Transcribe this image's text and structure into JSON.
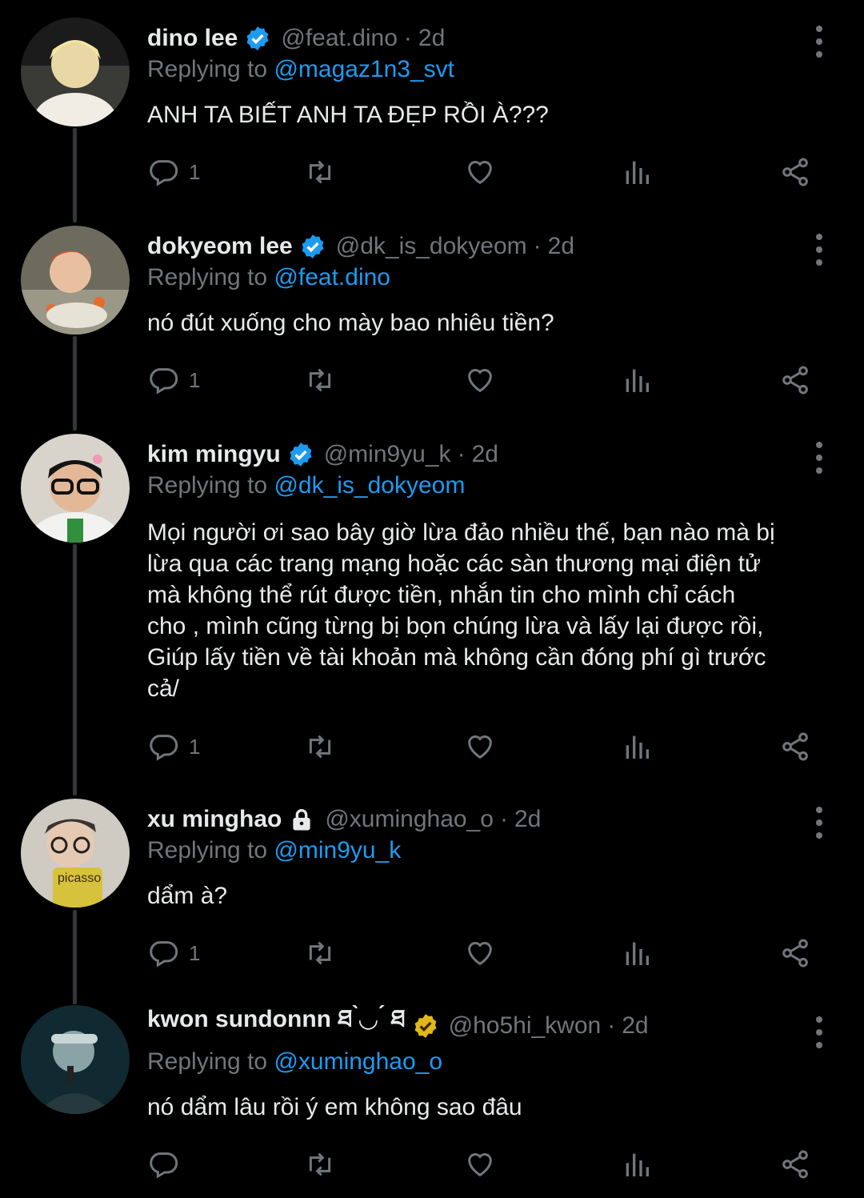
{
  "replying_prefix": "Replying to ",
  "colors": {
    "link": "#1d9bf0",
    "muted": "#71767b",
    "text": "#e7e9ea",
    "verified_blue": "#1d9bf0",
    "verified_gold": "#e2b719"
  },
  "tweets": [
    {
      "name": "dino lee",
      "badge": "verified-blue-icon",
      "handle": "@feat.dino",
      "dot": "·",
      "time": "2d",
      "replying_to": "@magaz1n3_svt",
      "lines": [
        "ANH TA BIẾT ANH TA ĐẸP RỒI À???"
      ],
      "reply_count": "1"
    },
    {
      "name": "dokyeom lee",
      "badge": "verified-blue-icon",
      "handle": "@dk_is_dokyeom",
      "dot": "·",
      "time": "2d",
      "replying_to": "@feat.dino",
      "lines": [
        "nó đút xuống cho mày bao nhiêu tiền?"
      ],
      "reply_count": "1"
    },
    {
      "name": "kim mingyu",
      "badge": "verified-blue-icon",
      "handle": "@min9yu_k",
      "dot": "·",
      "time": "2d",
      "replying_to": "@dk_is_dokyeom",
      "lines": [
        "Mọi người ơi sao bây giờ lừa đảo nhiều thế, bạn nào mà bị",
        "lừa qua các trang mạng hoặc các sàn thương mại điện tử",
        "mà không thể rút được tiền, nhắn tin cho mình chỉ cách",
        "cho , mình cũng từng bị bọn chúng lừa và lấy lại được rồi,",
        "Giúp lấy tiền về tài khoản mà không cần đóng phí gì trước",
        "cả/"
      ],
      "reply_count": "1"
    },
    {
      "name": "xu minghao",
      "badge": "lock-icon",
      "handle": "@xuminghao_o",
      "dot": "·",
      "time": "2d",
      "replying_to": "@min9yu_k",
      "lines": [
        "dẩm à?"
      ],
      "reply_count": "1"
    },
    {
      "name": "kwon sundonnn ཐ ̀◡ ́ ཐ",
      "badge": "verified-gold-icon",
      "handle": "@ho5hi_kwon",
      "dot": "·",
      "time": "2d",
      "replying_to": "@xuminghao_o",
      "lines": [
        "nó dẩm lâu rồi ý em không sao đâu"
      ],
      "reply_count": ""
    }
  ]
}
